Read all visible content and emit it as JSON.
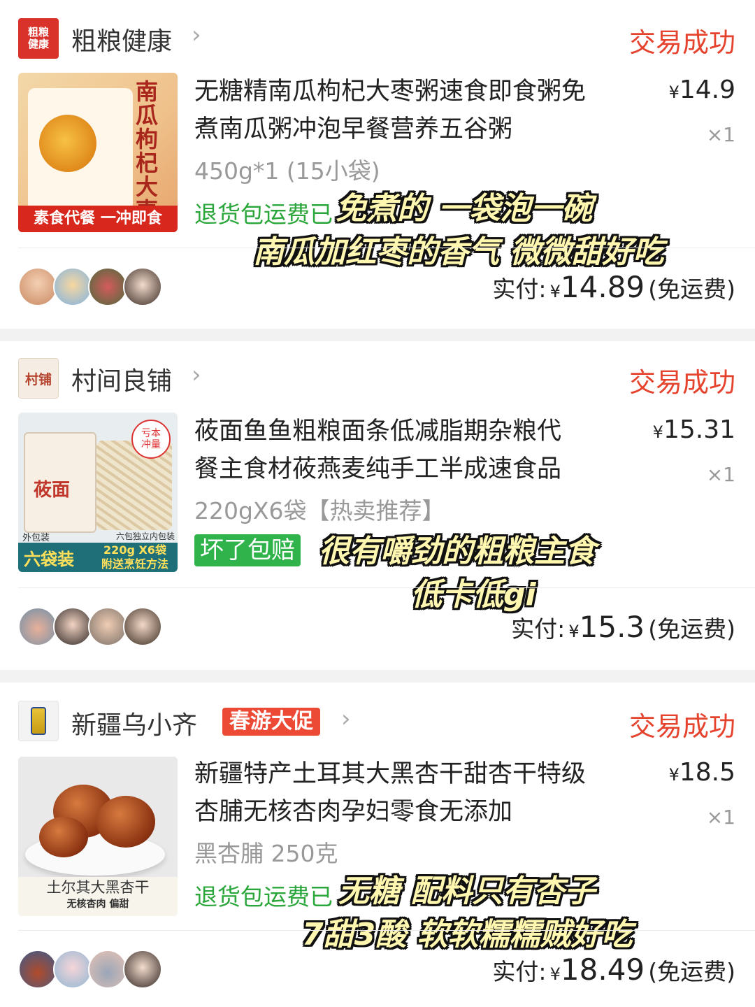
{
  "orders": [
    {
      "shop": {
        "logo_text": "粗粮\n健康",
        "name": "粗粮健康",
        "chevron": "›"
      },
      "status": "交易成功",
      "item": {
        "title_line1": "无糖精南瓜枸杞大枣粥速食即食粥免",
        "title_line2": "煮南瓜粥冲泡早餐营养五谷粥",
        "price_symbol": "¥",
        "price": "14.9",
        "qty": "×1",
        "spec": "450g*1 (15小袋)",
        "service": "退货包运费已",
        "image_text": {
          "vertical": "南瓜枸杞大枣粥",
          "band": "素食代餐 一冲即食"
        }
      },
      "payment": {
        "label": "实付:",
        "symbol": "¥",
        "amount": "14.89",
        "fee": "(免运费)"
      },
      "caption_lines": [
        "免煮的 一袋泡一碗",
        "南瓜加红枣的香气 微微甜好吃"
      ]
    },
    {
      "shop": {
        "logo_text": "村铺",
        "name": "村间良铺",
        "chevron": "›"
      },
      "status": "交易成功",
      "item": {
        "title_line1": "莜面鱼鱼粗粮面条低减脂期杂粮代",
        "title_line2": "餐主食材莜燕麦纯手工半成速食品",
        "price_symbol": "¥",
        "price": "15.31",
        "qty": "×1",
        "spec": "220gX6袋【热卖推荐】",
        "badge": "坏了包赔",
        "image_text": {
          "pack": "莜面",
          "stamp": "亏本\n冲量",
          "cap_left": "外包装",
          "cap_right": "六包独立内包装",
          "band_left": "六袋装",
          "band_right": "220g X6袋\n附送烹饪方法"
        }
      },
      "payment": {
        "label": "实付:",
        "symbol": "¥",
        "amount": "15.3",
        "fee": "(免运费)"
      },
      "caption_lines": [
        "很有嚼劲的粗粮主食",
        "低卡低gi"
      ]
    },
    {
      "shop": {
        "name": "新疆乌小齐",
        "promo": "春游大促",
        "chevron": "›"
      },
      "status": "交易成功",
      "item": {
        "title_line1": "新疆特产土耳其大黑杏干甜杏干特级",
        "title_line2": "杏脯无核杏肉孕妇零食无添加",
        "price_symbol": "¥",
        "price": "18.5",
        "qty": "×1",
        "spec": "黑杏脯 250克",
        "service": "退货包运费已",
        "image_text": {
          "label1": "土尔其大黑杏干",
          "label2": "无核杏肉 偏甜"
        }
      },
      "payment": {
        "label": "实付:",
        "symbol": "¥",
        "amount": "18.49",
        "fee": "(免运费)"
      },
      "caption_lines": [
        "无糖 配料只有杏子",
        "7甜3酸 软软糯糯贼好吃"
      ]
    }
  ],
  "colors": {
    "status": "#e5432e",
    "service_green": "#2aa63a",
    "badge_green": "#2fb34a",
    "promo_red": "#ec4a35",
    "caption_fill": "#fff7b0"
  }
}
